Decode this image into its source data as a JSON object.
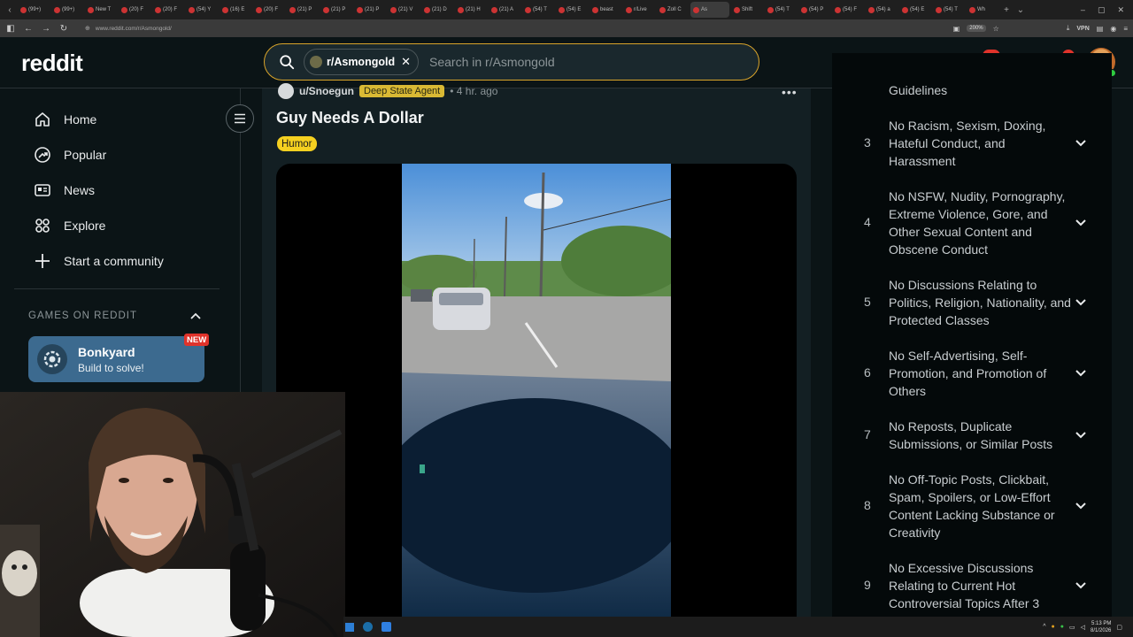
{
  "browser": {
    "tabs": [
      "(99+)",
      "(99+)",
      "New T",
      "(20) F",
      "(20) F",
      "(54) Y",
      "(16) E",
      "(20) F",
      "(21) P",
      "(21) P",
      "(21) P",
      "(21) V",
      "(21) D",
      "(21) H",
      "(21) A",
      "(54) T",
      "(54) E",
      "beast",
      "r/Live",
      "Zoll C",
      "As",
      "Shift",
      "(54) T",
      "(54) P",
      "(54) F",
      "(54) a",
      "(54) E",
      "(54) T",
      "Wh"
    ],
    "active_tab_index": 20,
    "url": "www.reddit.com/r/Asmongold/",
    "zoom": "200%",
    "vpn_label": "VPN"
  },
  "header": {
    "logo": "reddit",
    "community_chip": "r/Asmongold",
    "search_placeholder": "Search in r/Asmongold",
    "chat_badge": "99+",
    "notif_badge": "9"
  },
  "sidebar": {
    "items": [
      {
        "label": "Home",
        "icon": "home-icon"
      },
      {
        "label": "Popular",
        "icon": "popular-icon"
      },
      {
        "label": "News",
        "icon": "news-icon"
      },
      {
        "label": "Explore",
        "icon": "explore-icon"
      },
      {
        "label": "Start a community",
        "icon": "plus-icon"
      }
    ],
    "games_heading": "GAMES ON REDDIT",
    "game": {
      "title": "Bonkyard",
      "subtitle": "Build to solve!",
      "badge": "NEW"
    }
  },
  "post": {
    "author": "u/Snoegun",
    "user_flair": "Deep State Agent",
    "time": "• 4 hr. ago",
    "title": "Guy Needs A Dollar",
    "flair": "Humor"
  },
  "rules": {
    "partial_top": "Guidelines",
    "items": [
      {
        "num": "3",
        "text": "No Racism, Sexism, Doxing, Hateful Conduct, and Harassment"
      },
      {
        "num": "4",
        "text": "No NSFW, Nudity, Pornography, Extreme Violence, Gore, and Other Sexual Content and Obscene Conduct"
      },
      {
        "num": "5",
        "text": "No Discussions Relating to Politics, Religion, Nationality, and Protected Classes"
      },
      {
        "num": "6",
        "text": "No Self-Advertising, Self-Promotion, and Promotion of Others"
      },
      {
        "num": "7",
        "text": "No Reposts, Duplicate Submissions, or Similar Posts"
      },
      {
        "num": "8",
        "text": "No Off-Topic Posts, Clickbait, Spam, Spoilers, or Low-Effort Content Lacking Substance or Creativity"
      },
      {
        "num": "9",
        "text": "No Excessive Discussions Relating to Current Hot Controversial Topics After 3"
      }
    ]
  },
  "taskbar": {
    "time": "5:13 PM",
    "date": "8/1/2026"
  }
}
